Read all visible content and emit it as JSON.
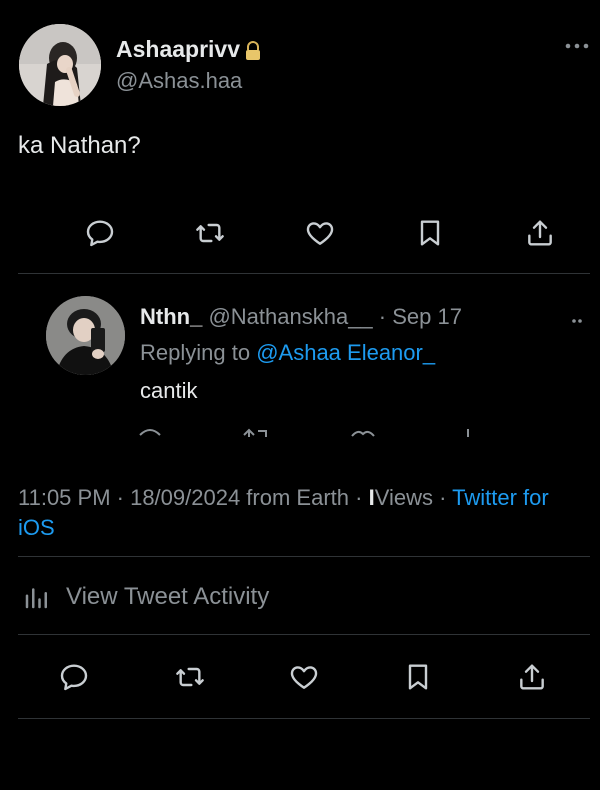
{
  "tweet": {
    "author": {
      "name": "Ashaaprivv",
      "handle": "@Ashas.haa"
    },
    "text": "ka Nathan?"
  },
  "reply": {
    "name": "Nthn_",
    "handle": "@Nathanskha__",
    "date": "· Sep 17",
    "replying_prefix": "Replying to",
    "replying_to": "@Ashaa Eleanor_",
    "text": "cantik"
  },
  "meta": {
    "time": "11:05 PM · 18/09/2024 from Earth ·",
    "views_count": "I",
    "views_label": "Views ·",
    "client": "Twitter for iOS"
  },
  "activity": {
    "label": "View Tweet Activity"
  },
  "icons": [
    "lock-icon",
    "more-icon",
    "reply-icon",
    "retweet-icon",
    "like-icon",
    "bookmark-icon",
    "share-icon",
    "analytics-icon"
  ],
  "colors": {
    "background": "#000000",
    "text": "#e7e9ea",
    "muted": "#8b9196",
    "link": "#1d9bf0",
    "divider": "#2f3336"
  }
}
